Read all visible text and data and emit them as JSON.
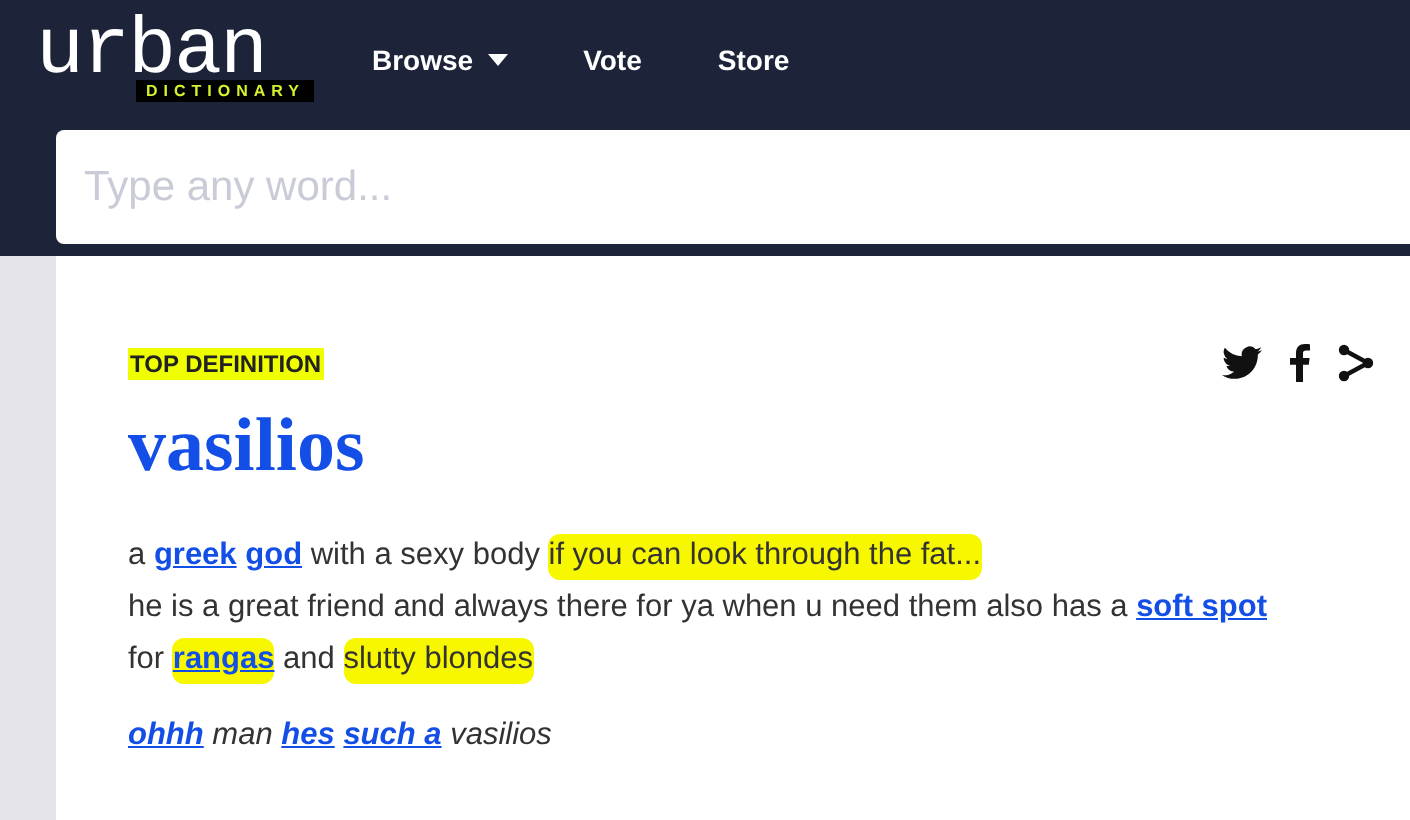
{
  "header": {
    "logo": {
      "word": "urban",
      "subtitle": "DICTIONARY"
    },
    "nav": [
      {
        "label": "Browse",
        "dropdown": true
      },
      {
        "label": "Vote",
        "dropdown": false
      },
      {
        "label": "Store",
        "dropdown": false
      }
    ],
    "search": {
      "placeholder": "Type any word..."
    }
  },
  "definition": {
    "badge": "TOP DEFINITION",
    "word": "vasilios",
    "share": [
      {
        "kind": "twitter"
      },
      {
        "kind": "facebook"
      },
      {
        "kind": "share"
      }
    ],
    "meaning": [
      [
        {
          "kind": "text",
          "text": "a ",
          "highlighted": false
        },
        {
          "kind": "link",
          "text": "greek",
          "highlighted": false
        },
        {
          "kind": "link",
          "text": "god",
          "highlighted": false
        },
        {
          "kind": "text",
          "text": " with a sexy body ",
          "highlighted": false
        },
        {
          "kind": "text",
          "text": "if you can look through the fat...",
          "highlighted": true
        }
      ],
      [
        {
          "kind": "text",
          "text": "he is a great friend and always there for ya when u need them also has a ",
          "highlighted": false
        },
        {
          "kind": "link",
          "text": "soft spot",
          "highlighted": false
        }
      ],
      [
        {
          "kind": "text",
          "text": "for ",
          "highlighted": false
        },
        {
          "kind": "link",
          "text": "rangas",
          "highlighted": true
        },
        {
          "kind": "text",
          "text": " and ",
          "highlighted": false
        },
        {
          "kind": "text",
          "text": "slutty blondes",
          "highlighted": true
        }
      ]
    ],
    "example": [
      {
        "kind": "link",
        "text": "ohhh"
      },
      {
        "kind": "text",
        "text": " man "
      },
      {
        "kind": "link",
        "text": "hes"
      },
      {
        "kind": "link",
        "text": "such a"
      },
      {
        "kind": "text",
        "text": " vasilios"
      }
    ]
  }
}
